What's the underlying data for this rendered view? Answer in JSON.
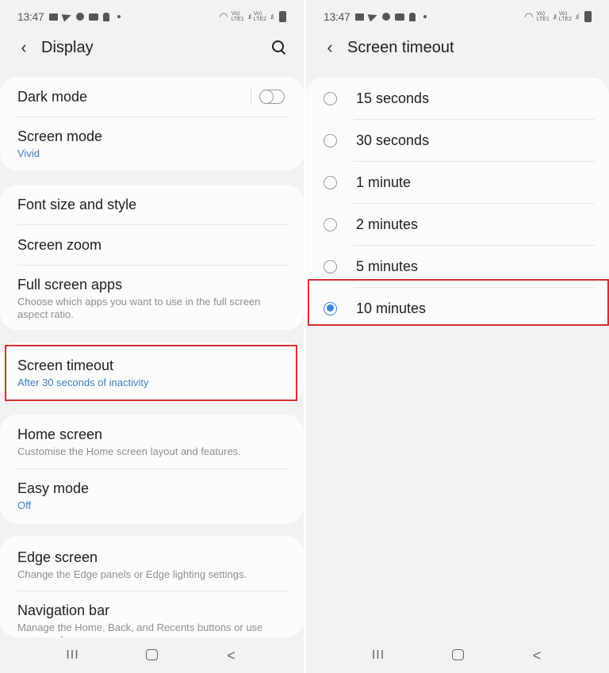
{
  "status_bar": {
    "time": "13:47",
    "left_icons": [
      "message-icon",
      "telegram-icon",
      "jio-icon",
      "youtube-icon",
      "download-icon",
      "dot-icon"
    ],
    "right_icons": [
      "wifi-icon",
      "volte-lte1-signal-icon",
      "volte-lte2-signal-icon",
      "battery-charging-icon"
    ],
    "sim1_label_top": "Vo)",
    "sim1_label_bottom": "LTE1",
    "sim2_label_top": "Vo)",
    "sim2_label_bottom": "LTE2"
  },
  "left": {
    "title": "Display",
    "groups": [
      {
        "items": [
          {
            "title": "Dark mode",
            "toggle": false
          },
          {
            "title": "Screen mode",
            "subtitle": "Vivid"
          }
        ]
      },
      {
        "items": [
          {
            "title": "Font size and style"
          },
          {
            "title": "Screen zoom"
          },
          {
            "title": "Full screen apps",
            "subtitle": "Choose which apps you want to use in the full screen aspect ratio."
          }
        ]
      },
      {
        "items": [
          {
            "title": "Screen timeout",
            "subtitle": "After 30 seconds of inactivity"
          }
        ]
      },
      {
        "items": [
          {
            "title": "Home screen",
            "subtitle": "Customise the Home screen layout and features."
          },
          {
            "title": "Easy mode",
            "subtitle": "Off"
          }
        ]
      },
      {
        "items": [
          {
            "title": "Edge screen",
            "subtitle": "Change the Edge panels or Edge lighting settings."
          },
          {
            "title": "Navigation bar",
            "subtitle": "Manage the Home, Back, and Recents buttons or use gestures for more screen space."
          }
        ]
      }
    ]
  },
  "right": {
    "title": "Screen timeout",
    "options": [
      {
        "label": "15 seconds",
        "selected": false
      },
      {
        "label": "30 seconds",
        "selected": false
      },
      {
        "label": "1 minute",
        "selected": false
      },
      {
        "label": "2 minutes",
        "selected": false
      },
      {
        "label": "5 minutes",
        "selected": false
      },
      {
        "label": "10 minutes",
        "selected": true
      }
    ]
  },
  "navbar": {
    "recents_glyph": "III",
    "back_glyph": "<"
  },
  "colors": {
    "accent_blue": "#3e7fc1",
    "radio_blue": "#3e84e6",
    "highlight_red": "#d32f2f",
    "background": "#f2f2f2",
    "card": "#fcfcfc"
  }
}
